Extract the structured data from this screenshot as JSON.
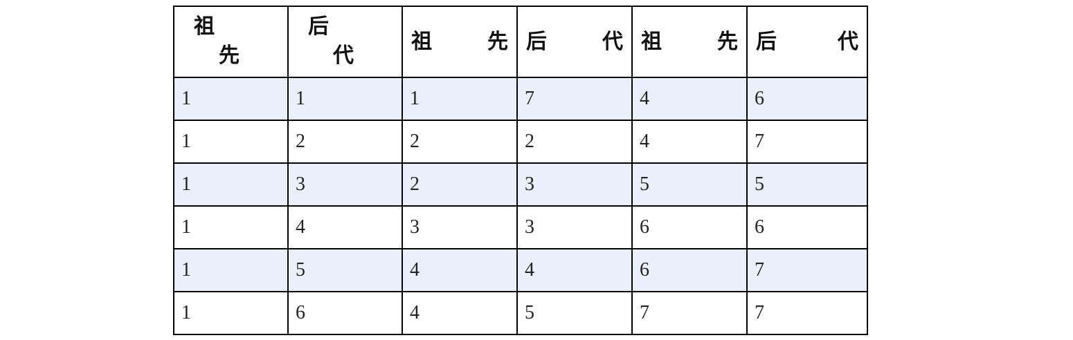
{
  "table": {
    "headers": [
      {
        "type": "stacked",
        "top": "祖",
        "bottom": "先"
      },
      {
        "type": "stacked",
        "top": "后",
        "bottom": "代"
      },
      {
        "type": "spread",
        "left": "祖",
        "right": "先"
      },
      {
        "type": "spread",
        "left": "后",
        "right": "代"
      },
      {
        "type": "spread",
        "left": "祖",
        "right": "先"
      },
      {
        "type": "spread",
        "left": "后",
        "right": "代"
      }
    ],
    "rows": [
      [
        "1",
        "1",
        "1",
        "7",
        "4",
        "6"
      ],
      [
        "1",
        "2",
        "2",
        "2",
        "4",
        "7"
      ],
      [
        "1",
        "3",
        "2",
        "3",
        "5",
        "5"
      ],
      [
        "1",
        "4",
        "3",
        "3",
        "6",
        "6"
      ],
      [
        "1",
        "5",
        "4",
        "4",
        "6",
        "7"
      ],
      [
        "1",
        "6",
        "4",
        "5",
        "7",
        "7"
      ]
    ],
    "shaded_row_color": "#eaf0fb"
  }
}
